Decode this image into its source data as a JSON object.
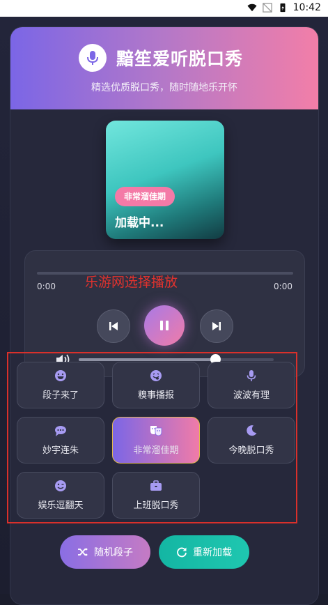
{
  "status_bar": {
    "time": "10:42"
  },
  "header": {
    "title": "黯笙爱听脱口秀",
    "subtitle": "精选优质脱口秀，随时随地乐开怀"
  },
  "now_playing": {
    "tag": "非常溜佳期",
    "title": "加载中..."
  },
  "player": {
    "current_time": "0:00",
    "total_time": "0:00",
    "overlay_label": "乐游网选择播放",
    "progress": 0,
    "volume": 0.7
  },
  "categories": [
    {
      "label": "段子来了",
      "icon": "laugh-icon"
    },
    {
      "label": "糗事播报",
      "icon": "grin-tongue-icon"
    },
    {
      "label": "波波有理",
      "icon": "microphone-icon"
    },
    {
      "label": "妙宇连朱",
      "icon": "chat-bubble-icon"
    },
    {
      "label": "非常溜佳期",
      "icon": "theater-masks-icon",
      "active": true
    },
    {
      "label": "今晚脱口秀",
      "icon": "moon-icon"
    },
    {
      "label": "娱乐逗翻天",
      "icon": "wink-icon"
    },
    {
      "label": "上班脱口秀",
      "icon": "briefcase-icon"
    }
  ],
  "actions": {
    "random_label": "随机段子",
    "reload_label": "重新加载"
  },
  "colors": {
    "accent_purple": "#7b66e6",
    "accent_pink": "#f07ba8",
    "teal_button": "#14b6a3",
    "highlight_red": "#d9302b",
    "icon_purple": "#a79bf2"
  }
}
